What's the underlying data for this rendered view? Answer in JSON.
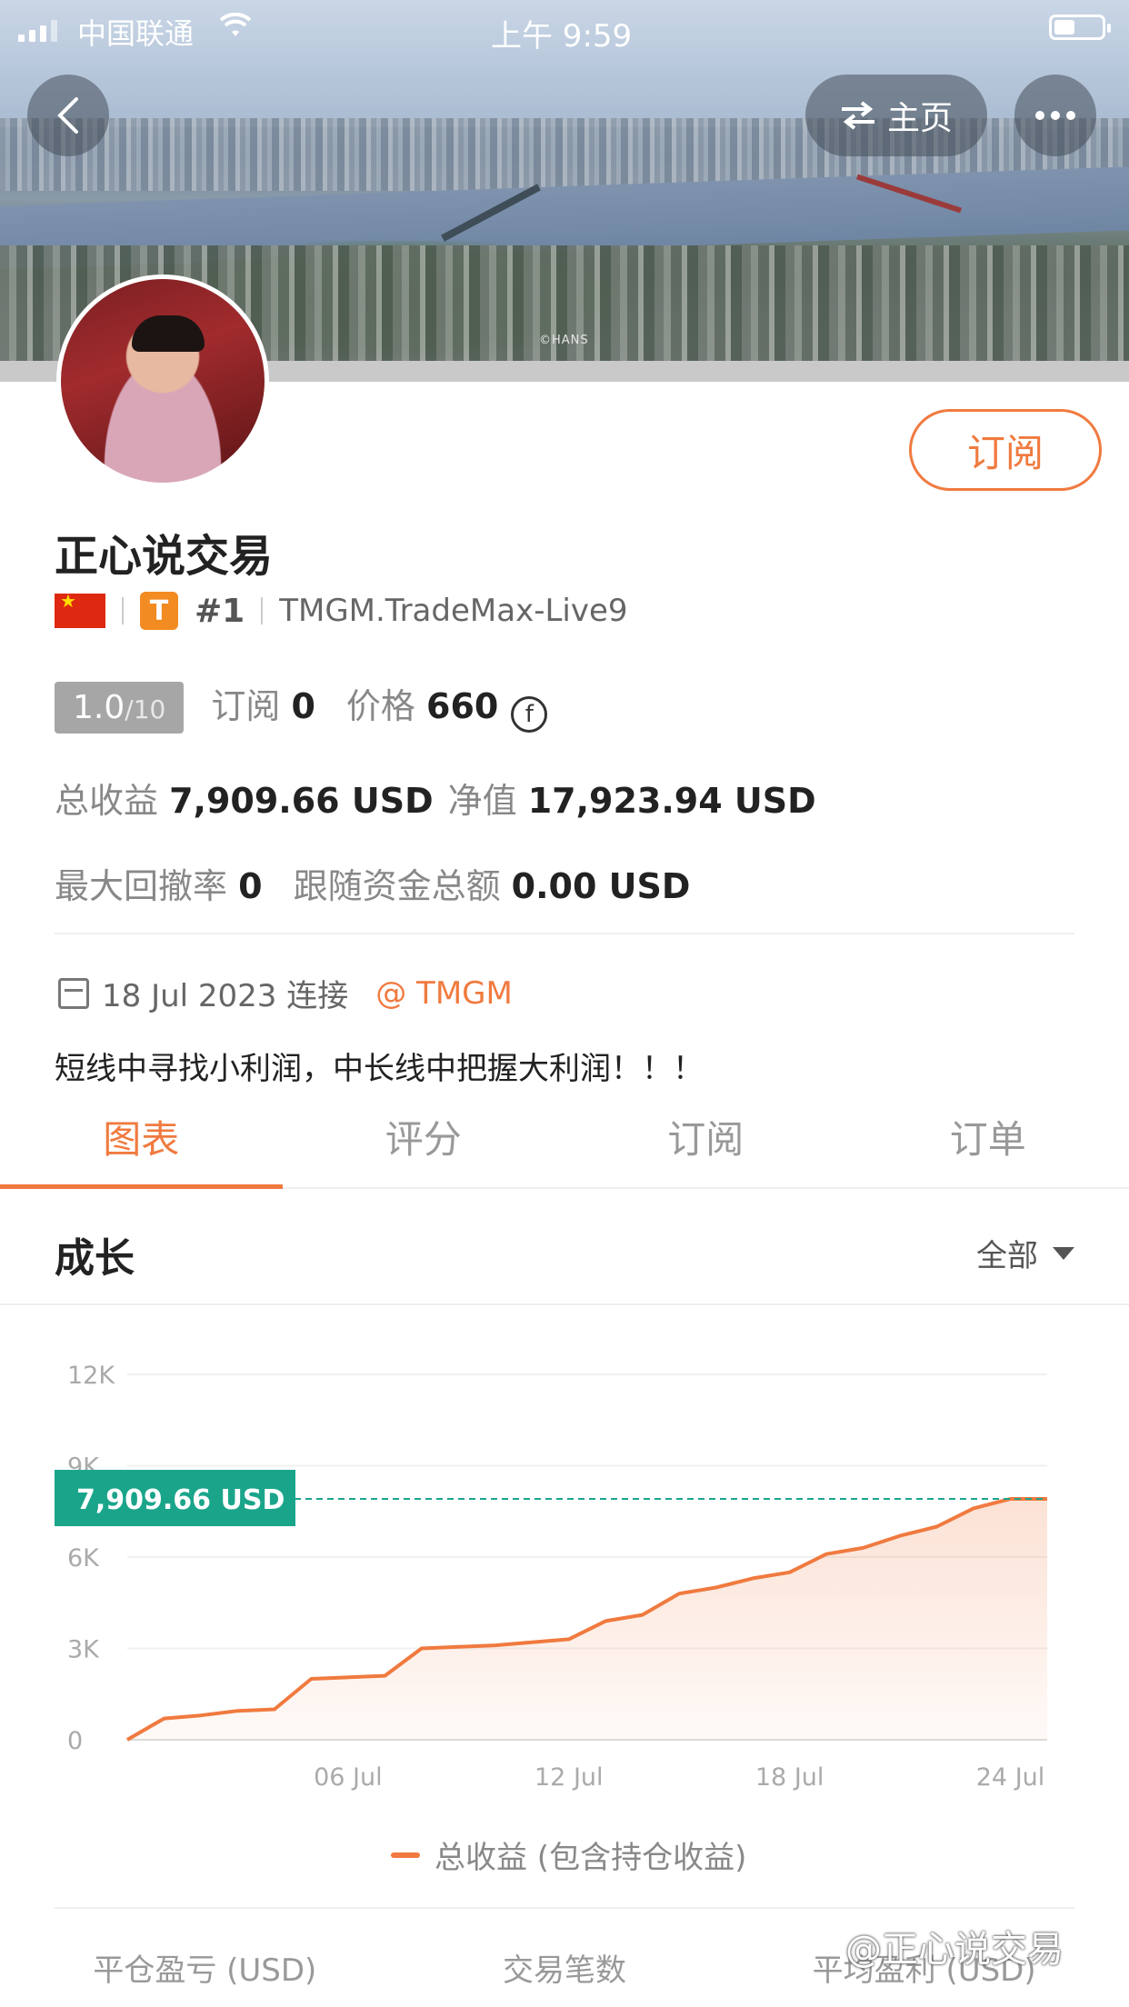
{
  "status_bar": {
    "carrier": "中国联通",
    "time": "上午 9:59"
  },
  "header": {
    "home_label": "主页",
    "banner_credit": "©HANS"
  },
  "profile": {
    "name": "正心说交易",
    "rank": "#1",
    "server": "TMGM.TradeMax-Live9",
    "tier_badge": "T",
    "subscribe_label": "订阅"
  },
  "stats": {
    "score": "1.0",
    "score_max": "/10",
    "subscribe_label": "订阅",
    "subscribe_count": "0",
    "price_label": "价格",
    "price": "660",
    "total_profit_label": "总收益",
    "total_profit": "7,909.66 USD",
    "equity_label": "净值",
    "equity": "17,923.94 USD",
    "max_drawdown_label": "最大回撤率",
    "max_drawdown": "0",
    "follow_funds_label": "跟随资金总额",
    "follow_funds": "0.00 USD"
  },
  "connect": {
    "date": "18 Jul 2023 连接",
    "broker": "@ TMGM"
  },
  "bio": "短线中寻找小利润，中长线中把握大利润！！！",
  "tabs": [
    {
      "label": "图表",
      "active": true
    },
    {
      "label": "评分",
      "active": false
    },
    {
      "label": "订阅",
      "active": false
    },
    {
      "label": "订单",
      "active": false
    }
  ],
  "section": {
    "title": "成长",
    "filter": "全部"
  },
  "chart_data": {
    "type": "area",
    "x": [
      "30 Jun",
      "01 Jul",
      "02 Jul",
      "03 Jul",
      "04 Jul",
      "05 Jul",
      "06 Jul",
      "07 Jul",
      "08 Jul",
      "09 Jul",
      "10 Jul",
      "11 Jul",
      "12 Jul",
      "13 Jul",
      "14 Jul",
      "15 Jul",
      "16 Jul",
      "17 Jul",
      "18 Jul",
      "19 Jul",
      "20 Jul",
      "21 Jul",
      "22 Jul",
      "23 Jul",
      "24 Jul",
      "25 Jul"
    ],
    "series": [
      {
        "name": "总收益 (包含持仓收益)",
        "values": [
          0,
          700,
          800,
          950,
          1000,
          2000,
          2050,
          2100,
          3000,
          3050,
          3100,
          3200,
          3300,
          3900,
          4100,
          4800,
          5000,
          5300,
          5500,
          6100,
          6300,
          6700,
          7000,
          7600,
          7909.66,
          7909.66
        ]
      }
    ],
    "xticks": [
      "06 Jul",
      "12 Jul",
      "18 Jul",
      "24 Jul"
    ],
    "yticks": [
      "0",
      "3K",
      "6K",
      "9K",
      "12K"
    ],
    "ylim": [
      0,
      12000
    ],
    "reference_line": {
      "value": 7909.66,
      "label": "7,909.66 USD"
    },
    "colors": {
      "line": "#f07a3f",
      "reference": "#1aa58b"
    }
  },
  "bottom_stats": [
    "平仓盈亏 (USD)",
    "交易笔数",
    "平均盈利 (USD)"
  ],
  "watermark": "@正心说交易"
}
